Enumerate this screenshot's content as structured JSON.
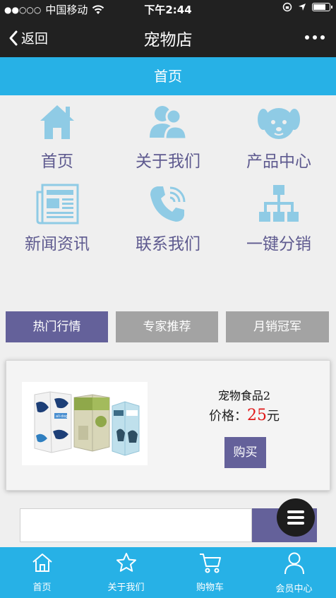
{
  "status_bar": {
    "signal_dots": "●●○○○",
    "carrier": "中国移动",
    "time": "下午2:44",
    "battery_level": 0.85
  },
  "nav": {
    "back_label": "返回",
    "title": "宠物店"
  },
  "sub_header": {
    "title": "首页"
  },
  "grid_items": [
    {
      "label": "首页",
      "icon": "home-icon"
    },
    {
      "label": "关于我们",
      "icon": "people-icon"
    },
    {
      "label": "产品中心",
      "icon": "dog-face-icon"
    },
    {
      "label": "新闻资讯",
      "icon": "newspaper-icon"
    },
    {
      "label": "联系我们",
      "icon": "phone-icon"
    },
    {
      "label": "一键分销",
      "icon": "hierarchy-icon"
    }
  ],
  "tabs": [
    {
      "label": "热门行情",
      "active": true
    },
    {
      "label": "专家推荐",
      "active": false
    },
    {
      "label": "月销冠军",
      "active": false
    }
  ],
  "product": {
    "name": "宠物食品2",
    "price_label": "价格：",
    "price_value": "25",
    "currency": "元",
    "buy_label": "购买",
    "image_text": "ali·dog"
  },
  "search": {
    "placeholder": ""
  },
  "tabbar": [
    {
      "label": "首页",
      "icon": "home-outline-icon"
    },
    {
      "label": "关于我们",
      "icon": "star-outline-icon"
    },
    {
      "label": "购物车",
      "icon": "cart-outline-icon"
    },
    {
      "label": "会员中心",
      "icon": "user-outline-icon"
    }
  ],
  "colors": {
    "nav_bg": "#212121",
    "accent_blue": "#27b1e6",
    "accent_purple": "#64619a",
    "icon_blue": "#8fcbe5",
    "tab_inactive": "#a3a3a3",
    "price_red": "#e01818"
  }
}
